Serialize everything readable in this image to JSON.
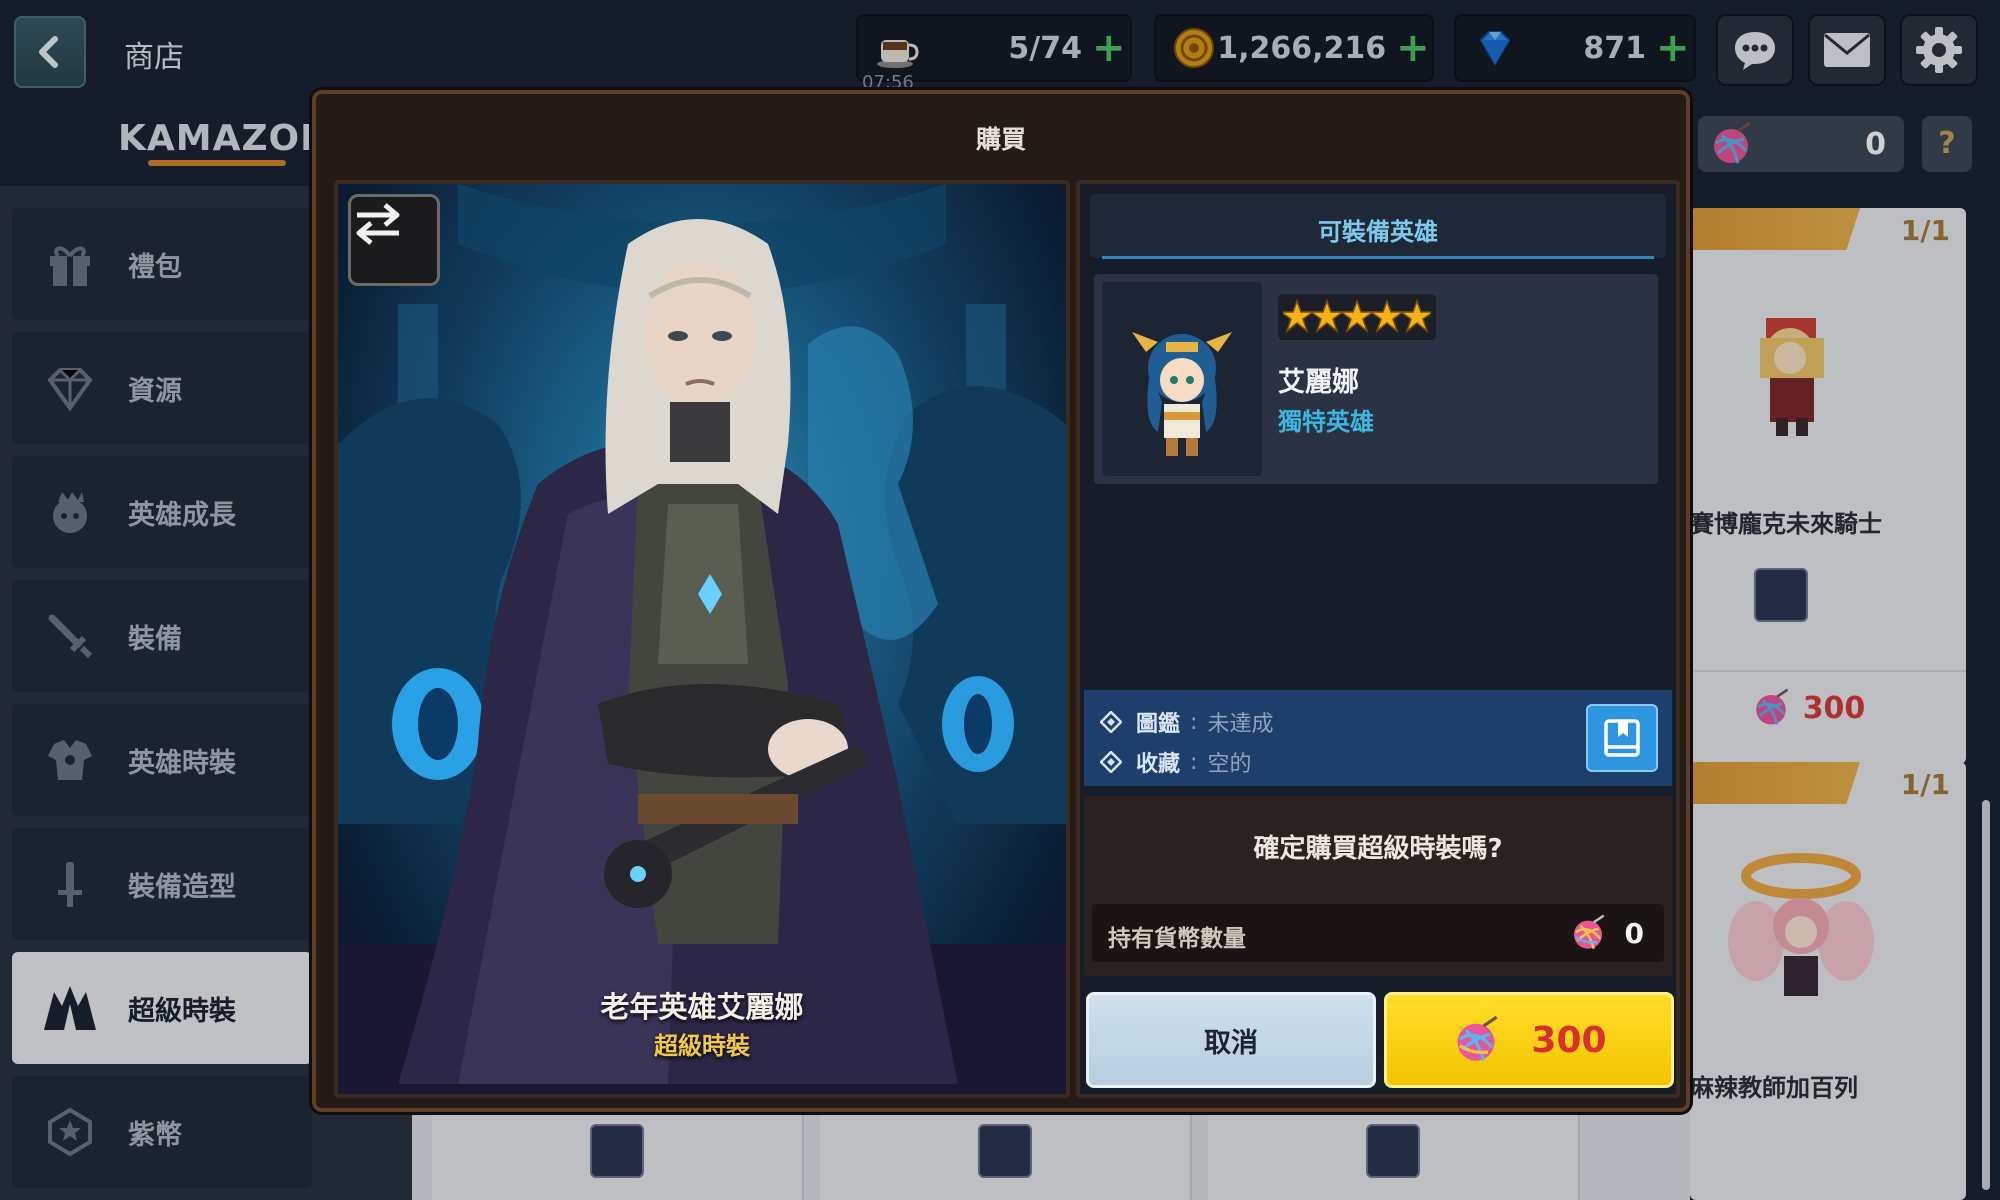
{
  "header": {
    "title": "商店",
    "stamina": "5/74",
    "stamina_timer": "07:56",
    "gold": "1,266,216",
    "gems": "871"
  },
  "sidebar": {
    "brand": "KAMAZON",
    "items": [
      {
        "label": "禮包",
        "icon": "gift-icon"
      },
      {
        "label": "資源",
        "icon": "diamond-icon"
      },
      {
        "label": "英雄成長",
        "icon": "hero-growth-icon"
      },
      {
        "label": "裝備",
        "icon": "sword-icon"
      },
      {
        "label": "英雄時裝",
        "icon": "costume-icon"
      },
      {
        "label": "裝備造型",
        "icon": "weapon-skin-icon"
      },
      {
        "label": "超級時裝",
        "icon": "super-costume-icon",
        "active": true
      },
      {
        "label": "紫幣",
        "icon": "purple-coin-icon"
      }
    ]
  },
  "shop": {
    "currency_count": "0",
    "help": "?",
    "cards": [
      {
        "count": "1/1",
        "name": "賽博龐克未來騎士",
        "price": "300"
      },
      {
        "count": "1/1",
        "name": "麻辣教師加百列"
      }
    ]
  },
  "modal": {
    "title": "購買",
    "costume_name": "老年英雄艾麗娜",
    "costume_type": "超級時裝",
    "equip_title": "可裝備英雄",
    "hero": {
      "name": "艾麗娜",
      "tag": "獨特英雄",
      "stars": 5
    },
    "collection": {
      "codex_label": "圖鑑",
      "codex_value": "未達成",
      "favorite_label": "收藏",
      "favorite_value": "空的",
      "separator": ":"
    },
    "confirm_question": "確定購買超級時裝嗎?",
    "held_label": "持有貨幣數量",
    "held_value": "0",
    "cancel_label": "取消",
    "buy_price": "300"
  },
  "colors": {
    "accent_gold": "#f4c400",
    "price_red": "#d6312d",
    "hero_tag_blue": "#3eb7e0",
    "modal_bg": "#241a16"
  }
}
